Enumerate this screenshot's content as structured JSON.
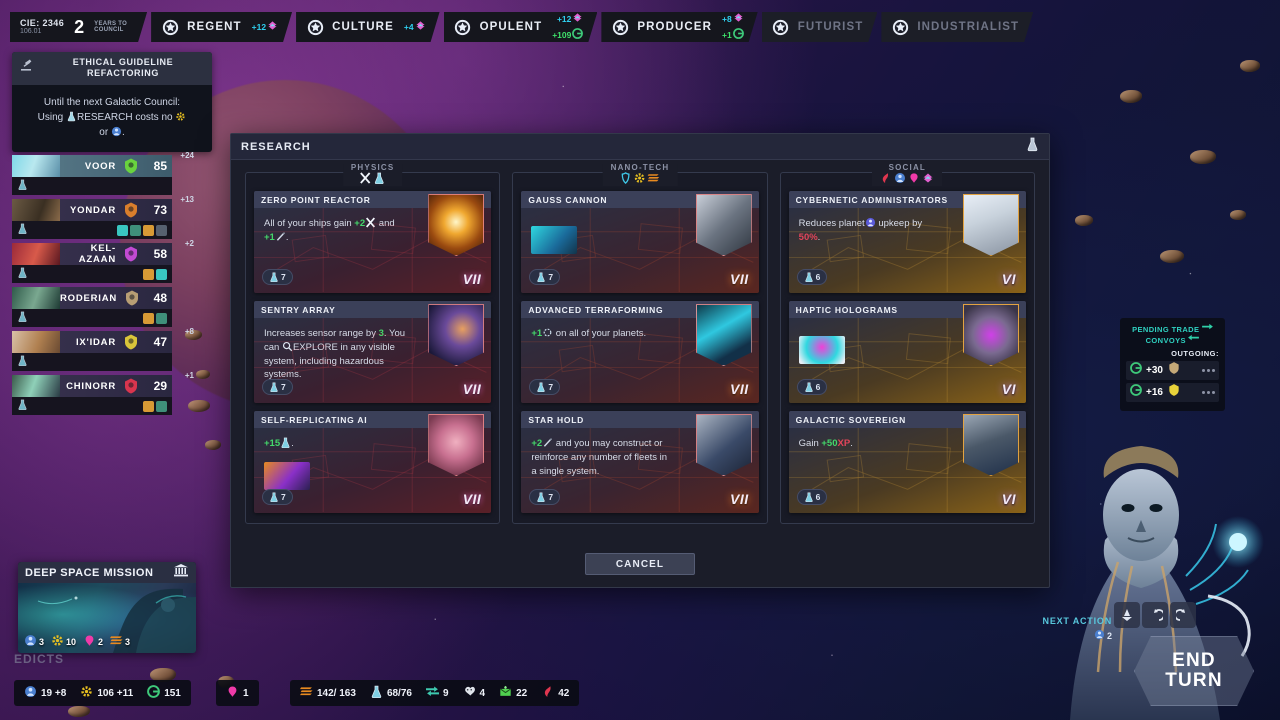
{
  "topbar": {
    "date": {
      "stardate": "CIE: 2346",
      "sub": "106.01",
      "turns": "2",
      "turns_label_line1": "YEARS TO",
      "turns_label_line2": "COUNCIL"
    },
    "parties": [
      {
        "name": "REGENT",
        "icon": "council-seal-icon",
        "active": true,
        "values": [
          {
            "text": "+12",
            "color": "#2fd0f0",
            "icon": "influence-icon"
          }
        ]
      },
      {
        "name": "CULTURE",
        "icon": "council-seal-icon",
        "active": true,
        "values": [
          {
            "text": "+4",
            "color": "#2fd0f0",
            "icon": "influence-icon"
          }
        ]
      },
      {
        "name": "OPULENT",
        "icon": "council-seal-icon",
        "active": true,
        "values": [
          {
            "text": "+12",
            "color": "#2fd0f0",
            "icon": "influence-icon"
          },
          {
            "text": "+109",
            "color": "#3ee06a",
            "icon": "credits-icon"
          }
        ]
      },
      {
        "name": "PRODUCER",
        "icon": "council-seal-icon",
        "active": true,
        "values": [
          {
            "text": "+8",
            "color": "#2fd0f0",
            "icon": "influence-icon"
          },
          {
            "text": "+1",
            "color": "#3ee06a",
            "icon": "credits-icon"
          }
        ]
      },
      {
        "name": "FUTURIST",
        "icon": "council-seal-icon",
        "active": false,
        "values": []
      },
      {
        "name": "INDUSTRIALIST",
        "icon": "council-seal-icon",
        "active": false,
        "values": []
      }
    ]
  },
  "guideline": {
    "icon": "gavel-icon",
    "title_line1": "ETHICAL GUIDELINE",
    "title_line2": "REFACTORING",
    "body_line1": "Until the next Galactic Council:",
    "body_line2_pre": "Using ",
    "body_line2_mid": "RESEARCH",
    "body_line2_post": " costs no ",
    "body_line3_pre": "or ",
    "body_line3_post": "."
  },
  "empires": [
    {
      "name": "VOOR",
      "score": "85",
      "plus": "+24",
      "leader": true,
      "crest_color": "#6ddc3a",
      "portrait": "voor-portrait",
      "badges": []
    },
    {
      "name": "YONDAR",
      "score": "73",
      "plus": "+13",
      "leader": false,
      "crest_color": "#e8852a",
      "portrait": "yondar-portrait",
      "badges": [
        "#39c6c0",
        "#3f8f7a",
        "#d89a35",
        "#56606f"
      ]
    },
    {
      "name": "KEL-AZAAN",
      "score": "58",
      "plus": "+2",
      "leader": false,
      "crest_color": "#cf4de0",
      "portrait": "kelazaan-portrait",
      "badges": [
        "#d89a35",
        "#39c6c0"
      ]
    },
    {
      "name": "RODERIAN",
      "score": "48",
      "plus": "",
      "leader": false,
      "crest_color": "#c4a878",
      "portrait": "roderian-portrait",
      "badges": [
        "#d89a35",
        "#3f8f7a"
      ]
    },
    {
      "name": "IX'IDAR",
      "score": "47",
      "plus": "+8",
      "leader": false,
      "crest_color": "#e8d23a",
      "portrait": "ixidar-portrait",
      "badges": []
    },
    {
      "name": "CHINORR",
      "score": "29",
      "plus": "+1",
      "leader": false,
      "crest_color": "#e8364f",
      "portrait": "chinorr-portrait",
      "badges": [
        "#d89a35",
        "#3f8f7a"
      ]
    }
  ],
  "research": {
    "window_title": "RESEARCH",
    "header_icon": "research-flask-icon",
    "cancel_label": "CANCEL",
    "columns": [
      {
        "name": "PHYSICS",
        "icons": [
          "weapons-x-icon",
          "research-flask-icon"
        ],
        "theme": "physics",
        "cards": [
          {
            "title": "ZERO POINT REACTOR",
            "desc_parts": [
              {
                "t": "All of your ships gain ",
                "c": "n"
              },
              {
                "t": "+2",
                "c": "g"
              },
              {
                "t": "X",
                "c": "icon-attack"
              },
              {
                "t": " and ",
                "c": "n"
              },
              {
                "t": "+1",
                "c": "g"
              },
              {
                "t": "✦",
                "c": "icon-move"
              },
              {
                "t": ".",
                "c": "n"
              }
            ],
            "cost": "7",
            "cost_icon": "research-flask-icon",
            "tier": "VII",
            "tier_style": "pink",
            "art": "zero-point-reactor-art",
            "has_inline_art": false
          },
          {
            "title": "SENTRY ARRAY",
            "desc_parts": [
              {
                "t": "Increases sensor range by ",
                "c": "n"
              },
              {
                "t": "3",
                "c": "g"
              },
              {
                "t": ". You can ",
                "c": "n"
              },
              {
                "t": "🔍",
                "c": "icon-explore"
              },
              {
                "t": "EXPLORE",
                "c": "n"
              },
              {
                "t": " in any visible system, including hazardous systems.",
                "c": "n"
              }
            ],
            "cost": "7",
            "cost_icon": "research-flask-icon",
            "tier": "VII",
            "tier_style": "pink",
            "art": "sentry-array-art",
            "has_inline_art": false
          },
          {
            "title": "SELF-REPLICATING AI",
            "desc_parts": [
              {
                "t": "+15",
                "c": "g"
              },
              {
                "t": "⚗",
                "c": "icon-research"
              },
              {
                "t": ".",
                "c": "n"
              }
            ],
            "cost": "7",
            "cost_icon": "research-flask-icon",
            "tier": "VII",
            "tier_style": "pink",
            "art": "self-replicating-ai-art",
            "has_inline_art": true,
            "inline_art": "improvement-thumb"
          }
        ]
      },
      {
        "name": "NANO-TECH",
        "icons": [
          "shield-icon",
          "gear-icon",
          "production-icon"
        ],
        "theme": "nano",
        "cards": [
          {
            "title": "GAUSS CANNON",
            "desc_parts": [],
            "cost": "7",
            "cost_icon": "research-flask-icon",
            "tier": "VII",
            "tier_style": "orange",
            "art": "gauss-cannon-art",
            "has_inline_art": true,
            "inline_art": "gauss-thumb"
          },
          {
            "title": "ADVANCED TERRAFORMING",
            "desc_parts": [
              {
                "t": "+1",
                "c": "g"
              },
              {
                "t": "⬡",
                "c": "icon-planet"
              },
              {
                "t": " on all of your planets.",
                "c": "n"
              }
            ],
            "cost": "7",
            "cost_icon": "research-flask-icon",
            "tier": "VII",
            "tier_style": "orange",
            "art": "advanced-terraforming-art",
            "has_inline_art": false
          },
          {
            "title": "STAR HOLD",
            "desc_parts": [
              {
                "t": "+2",
                "c": "g"
              },
              {
                "t": "✦",
                "c": "icon-move"
              },
              {
                "t": " and you may construct or reinforce any number of fleets in a single system.",
                "c": "n"
              }
            ],
            "cost": "7",
            "cost_icon": "research-flask-icon",
            "tier": "VII",
            "tier_style": "orange",
            "art": "star-hold-art",
            "has_inline_art": false
          }
        ]
      },
      {
        "name": "SOCIAL",
        "icons": [
          "diplomacy-icon",
          "population-icon",
          "culture-icon",
          "influence-icon"
        ],
        "theme": "social",
        "cards": [
          {
            "title": "CYBERNETIC ADMINISTRATORS",
            "desc_parts": [
              {
                "t": "Reduces planet",
                "c": "n"
              },
              {
                "t": "◉",
                "c": "icon-pop"
              },
              {
                "t": " upkeep by ",
                "c": "n"
              },
              {
                "t": "50%",
                "c": "r"
              },
              {
                "t": ".",
                "c": "n"
              }
            ],
            "cost": "6",
            "cost_icon": "research-flask-icon",
            "tier": "VI",
            "tier_style": "purple",
            "art": "cybernetic-administrators-art",
            "has_inline_art": false
          },
          {
            "title": "HAPTIC HOLOGRAMS",
            "desc_parts": [],
            "cost": "6",
            "cost_icon": "research-flask-icon",
            "tier": "VI",
            "tier_style": "purple",
            "art": "haptic-holograms-art",
            "has_inline_art": true,
            "inline_art": "hologram-thumb"
          },
          {
            "title": "GALACTIC SOVEREIGN",
            "desc_parts": [
              {
                "t": "Gain ",
                "c": "n"
              },
              {
                "t": "+50",
                "c": "g"
              },
              {
                "t": "XP",
                "c": "xp"
              },
              {
                "t": ".",
                "c": "n"
              }
            ],
            "cost": "6",
            "cost_icon": "research-flask-icon",
            "tier": "VI",
            "tier_style": "purple",
            "art": "galactic-sovereign-art",
            "has_inline_art": false
          }
        ]
      }
    ]
  },
  "convoys": {
    "title_line1": "PENDING TRADE",
    "title_line2": "CONVOYS",
    "subtitle": "OUTGOING:",
    "rows": [
      {
        "amount": "+30",
        "icon": "credits-icon",
        "empire_crest": "roderian-crest",
        "crest_color": "#c4a878"
      },
      {
        "amount": "+16",
        "icon": "credits-icon",
        "empire_crest": "ixidar-crest",
        "crest_color": "#e8d23a"
      }
    ]
  },
  "mission": {
    "title": "DEEP SPACE MISSION",
    "icon": "senate-building-icon",
    "costs": [
      {
        "value": "3",
        "icon": "population-icon",
        "color": "#5f8fe0"
      },
      {
        "value": "10",
        "icon": "gear-icon",
        "color": "#e8c020"
      },
      {
        "value": "2",
        "icon": "culture-icon",
        "color": "#f03aa8"
      },
      {
        "value": "3",
        "icon": "production-icon",
        "color": "#e88a20"
      }
    ]
  },
  "edicts_label": "EDICTS",
  "bottom_bars": {
    "left": [
      {
        "icon": "population-icon",
        "value": "19 +8",
        "color": "#5f8fe0"
      },
      {
        "icon": "gear-icon",
        "value": "106 +11",
        "color": "#e8c020"
      },
      {
        "icon": "credits-icon",
        "value": "151",
        "color": "#3ec97a"
      }
    ],
    "middle": [
      {
        "icon": "culture-icon",
        "value": "1",
        "color": "#f03aa8"
      }
    ],
    "right": [
      {
        "icon": "production-icon",
        "value": "142/ 163",
        "color": "#e88a20"
      },
      {
        "icon": "research-flask-icon",
        "value": "68/76",
        "color": "#7fd8e8"
      },
      {
        "icon": "trade-icon",
        "value": "9",
        "color": "#3ec9b0"
      },
      {
        "icon": "approval-icon",
        "value": "4",
        "color": "#e0e4ea"
      },
      {
        "icon": "food-icon",
        "value": "22",
        "color": "#4fd04f"
      },
      {
        "icon": "military-icon",
        "value": "42",
        "color": "#e0364f"
      }
    ]
  },
  "footer": {
    "next_action_label": "NEXT ACTION",
    "next_action_value": "2",
    "next_action_icon": "population-icon",
    "buttons": [
      {
        "name": "unit-select-button",
        "glyph": "✈"
      },
      {
        "name": "undo-button",
        "glyph": "↺"
      },
      {
        "name": "redo-button",
        "glyph": "↻"
      }
    ],
    "end_turn_line1": "END",
    "end_turn_line2": "TURN"
  }
}
